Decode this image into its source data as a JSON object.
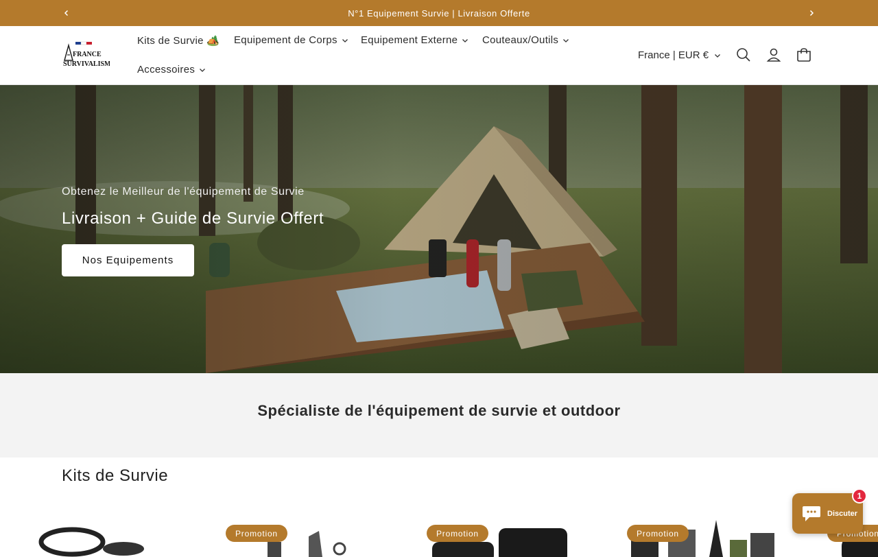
{
  "announcement": {
    "text": "N°1 Equipement Survie | Livraison Offerte"
  },
  "header": {
    "logo": {
      "line1": "FRANCE",
      "line2": "SURVIVALISME"
    },
    "nav": [
      {
        "label": "Kits de Survie 🏕️"
      },
      {
        "label": "Equipement de Corps"
      },
      {
        "label": "Equipement Externe"
      },
      {
        "label": "Couteaux/Outils"
      },
      {
        "label": "Accessoires"
      }
    ],
    "locale": "France | EUR €"
  },
  "hero": {
    "subtitle": "Obtenez le Meilleur de l'équipement de Survie",
    "title": "Livraison + Guide de Survie Offert",
    "button": "Nos Equipements"
  },
  "band": {
    "heading": "Spécialiste de l'équipement de survie et outdoor"
  },
  "collection": {
    "title": "Kits de Survie",
    "badges": [
      "Promotion",
      "Promotion",
      "Promotion",
      "Promotion"
    ]
  },
  "chat": {
    "label": "Discuter",
    "count": "1"
  },
  "colors": {
    "accent": "#b47a2c",
    "chat_badge": "#e3283e"
  }
}
